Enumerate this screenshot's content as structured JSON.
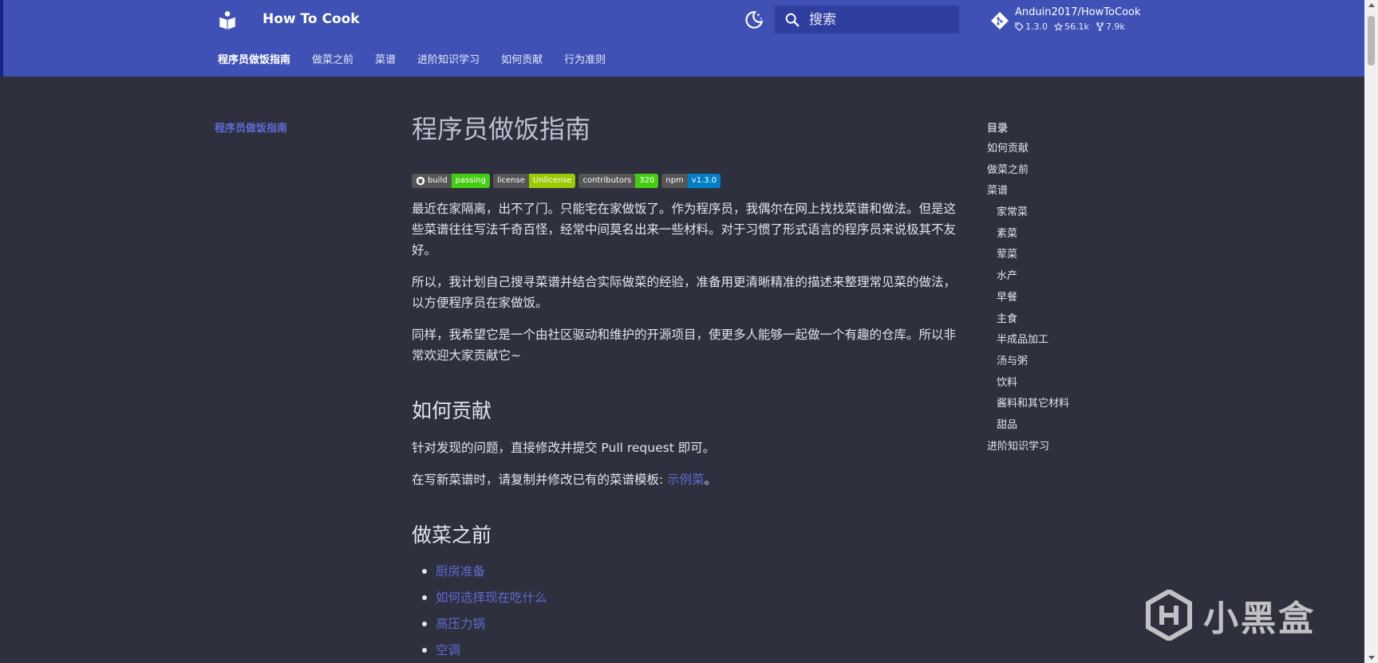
{
  "header": {
    "site_title": "How To Cook",
    "search_placeholder": "搜索",
    "repo": {
      "name": "Anduin2017/HowToCook",
      "version": "1.3.0",
      "stars": "56.1k",
      "forks": "7.9k"
    },
    "tabs": [
      {
        "label": "程序员做饭指南",
        "active": true
      },
      {
        "label": "做菜之前"
      },
      {
        "label": "菜谱"
      },
      {
        "label": "进阶知识学习"
      },
      {
        "label": "如何贡献"
      },
      {
        "label": "行为准则"
      }
    ]
  },
  "left_nav": {
    "item": "程序员做饭指南"
  },
  "content": {
    "title": "程序员做饭指南",
    "badges": [
      {
        "left": "build",
        "right": "passing",
        "color": "#4c1"
      },
      {
        "left": "license",
        "right": "Unlicense",
        "color": "#97ca00"
      },
      {
        "left": "contributors",
        "right": "320",
        "color": "#4c1"
      },
      {
        "left": "npm",
        "right": "v1.3.0",
        "color": "#007ec6"
      }
    ],
    "paragraphs": [
      "最近在家隔离，出不了门。只能宅在家做饭了。作为程序员，我偶尔在网上找找菜谱和做法。但是这些菜谱往往写法千奇百怪，经常中间莫名出来一些材料。对于习惯了形式语言的程序员来说极其不友好。",
      "所以，我计划自己搜寻菜谱并结合实际做菜的经验，准备用更清晰精准的描述来整理常见菜的做法，以方便程序员在家做饭。",
      "同样，我希望它是一个由社区驱动和维护的开源项目，使更多人能够一起做一个有趣的仓库。所以非常欢迎大家贡献它~"
    ],
    "contribute": {
      "heading": "如何贡献",
      "p1": "针对发现的问题，直接修改并提交 Pull request 即可。",
      "p2_prefix": "在写新菜谱时，请复制并修改已有的菜谱模板: ",
      "p2_link": "示例菜",
      "p2_suffix": "。"
    },
    "before_cooking": {
      "heading": "做菜之前",
      "items": [
        "厨房准备",
        "如何选择现在吃什么",
        "高压力锅",
        "空调"
      ]
    }
  },
  "toc": {
    "title": "目录",
    "items": [
      {
        "label": "如何贡献",
        "sub": false
      },
      {
        "label": "做菜之前",
        "sub": false
      },
      {
        "label": "菜谱",
        "sub": false
      },
      {
        "label": "家常菜",
        "sub": true
      },
      {
        "label": "素菜",
        "sub": true
      },
      {
        "label": "荤菜",
        "sub": true
      },
      {
        "label": "水产",
        "sub": true
      },
      {
        "label": "早餐",
        "sub": true
      },
      {
        "label": "主食",
        "sub": true
      },
      {
        "label": "半成品加工",
        "sub": true
      },
      {
        "label": "汤与粥",
        "sub": true
      },
      {
        "label": "饮料",
        "sub": true
      },
      {
        "label": "酱料和其它材料",
        "sub": true
      },
      {
        "label": "甜品",
        "sub": true
      },
      {
        "label": "进阶知识学习",
        "sub": false
      }
    ]
  },
  "watermark": {
    "text": "小黑盒"
  },
  "colors": {
    "header_bg": "#3f51b5",
    "body_bg": "#2e303e",
    "link": "#5e6ad2",
    "search_bg": "#303f9f"
  }
}
